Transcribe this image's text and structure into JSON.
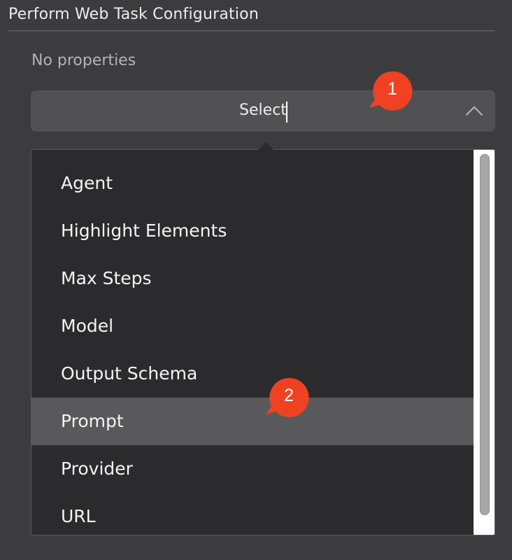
{
  "panel": {
    "title": "Perform Web Task Configuration",
    "empty_text": "No properties"
  },
  "select": {
    "value": "Select",
    "value_before_caret": "Sel",
    "value_after_caret": "ect",
    "chevron_icon": "chevron-up-icon",
    "expanded": true
  },
  "dropdown": {
    "options": [
      {
        "label": "Agent",
        "selected": false
      },
      {
        "label": "Highlight Elements",
        "selected": false
      },
      {
        "label": "Max Steps",
        "selected": false
      },
      {
        "label": "Model",
        "selected": false
      },
      {
        "label": "Output Schema",
        "selected": false
      },
      {
        "label": "Prompt",
        "selected": true
      },
      {
        "label": "Provider",
        "selected": false
      },
      {
        "label": "URL",
        "selected": false
      }
    ]
  },
  "annotations": [
    {
      "number": "1"
    },
    {
      "number": "2"
    }
  ],
  "colors": {
    "background": "#3c3c3e",
    "select_bg": "#515153",
    "dropdown_bg": "#2b2b2d",
    "selected_option_bg": "#59595b",
    "badge": "#ef4223",
    "text": "#ededed"
  }
}
